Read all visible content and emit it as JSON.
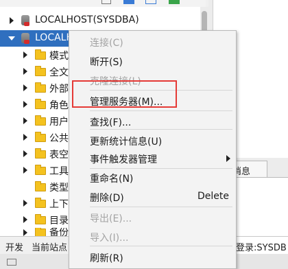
{
  "tree": {
    "nodes": [
      {
        "label": "LOCALHOST(SYSDBA)"
      },
      {
        "label": "LOCALHO"
      },
      {
        "label": "模式"
      },
      {
        "label": "全文"
      },
      {
        "label": "外部"
      },
      {
        "label": "角色"
      },
      {
        "label": "用户"
      },
      {
        "label": "公共"
      },
      {
        "label": "表空"
      },
      {
        "label": "工具"
      },
      {
        "label": "类型"
      },
      {
        "label": "上下"
      },
      {
        "label": "目录"
      },
      {
        "label": "备份"
      }
    ]
  },
  "right_panel": {
    "tab_label": "消息"
  },
  "status_bar": {
    "left_text": "开发",
    "station_text": "当前站点",
    "login_text": "登录:SYSDB"
  },
  "context_menu": {
    "items": [
      {
        "label": "连接(C)",
        "disabled": true
      },
      {
        "label": "断开(S)",
        "disabled": false
      },
      {
        "label": "克隆连接(L)",
        "disabled": true
      },
      {
        "label": "管理服务器(M)...",
        "disabled": false
      },
      {
        "label": "查找(F)...",
        "disabled": false
      },
      {
        "label": "更新统计信息(U)",
        "disabled": false
      },
      {
        "label": "事件触发器管理",
        "disabled": false,
        "submenu": true
      },
      {
        "label": "重命名(N)",
        "disabled": false
      },
      {
        "label": "删除(D)",
        "shortcut": "Delete",
        "disabled": false
      },
      {
        "label": "导出(E)...",
        "disabled": true
      },
      {
        "label": "导入(I)...",
        "disabled": true
      },
      {
        "label": "刷新(R)",
        "disabled": false
      }
    ]
  },
  "colors": {
    "selection": "#2f6fbf",
    "highlight_box": "#e53935",
    "folder": "#f4c21f",
    "disabled_text": "#a3a3a3"
  }
}
